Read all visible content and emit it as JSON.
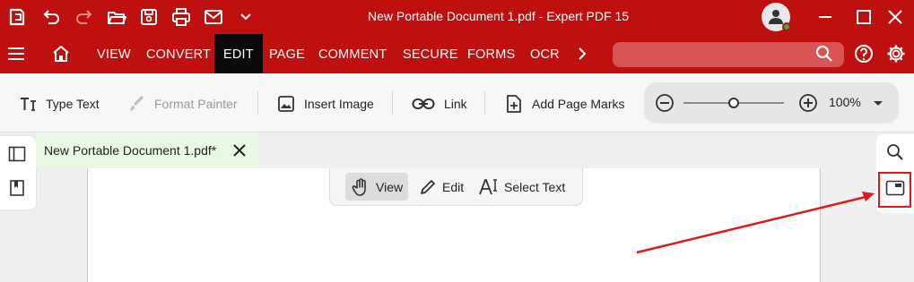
{
  "window": {
    "title": "New Portable Document 1.pdf - Expert PDF 15"
  },
  "quick_access": {
    "icons": [
      "app-logo-icon",
      "undo-icon",
      "redo-icon",
      "open-folder-icon",
      "save-icon",
      "print-icon",
      "email-icon",
      "chevron-down-icon"
    ]
  },
  "menu": {
    "items": [
      "VIEW",
      "CONVERT",
      "EDIT",
      "PAGE",
      "COMMENT",
      "SECURE",
      "FORMS",
      "OCR"
    ],
    "active": "EDIT",
    "search_value": ""
  },
  "toolbar": {
    "type_text": "Type Text",
    "format_painter": "Format Painter",
    "insert_image": "Insert Image",
    "link": "Link",
    "add_page_marks": "Add Page Marks",
    "zoom_level": "100%",
    "zoom_slider": 0.5
  },
  "document": {
    "tab_title": "New Portable Document 1.pdf*"
  },
  "modes": {
    "view": "View",
    "edit": "Edit",
    "select_text": "Select Text",
    "active": "View"
  },
  "colors": {
    "brand_red": "#bf0f0f",
    "active_tab_bg": "#0a0a0a",
    "doc_tab_bg": "#e9f8e3",
    "annotation_red": "#e01818",
    "status_online": "#2fb34a"
  }
}
